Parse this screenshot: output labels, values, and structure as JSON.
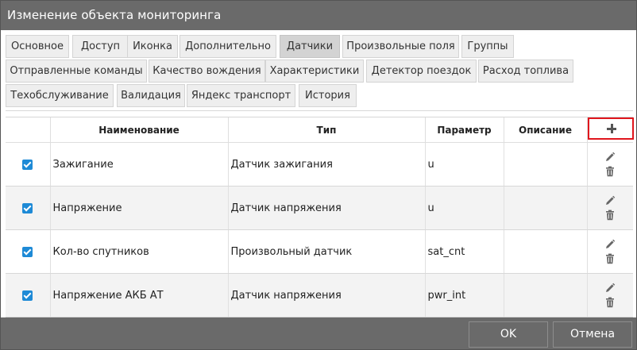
{
  "dialog": {
    "title": "Изменение объекта мониторинга"
  },
  "tabs_row1": [
    {
      "label": "Основное"
    },
    {
      "label": "Доступ"
    },
    {
      "label": "Иконка"
    },
    {
      "label": "Дополнительно"
    },
    {
      "label": "Датчики",
      "active": true
    },
    {
      "label": "Произвольные поля"
    },
    {
      "label": "Группы"
    }
  ],
  "tabs_row2": [
    {
      "label": "Отправленные команды"
    },
    {
      "label": "Качество вождения"
    },
    {
      "label": "Характеристики"
    },
    {
      "label": "Детектор поездок"
    },
    {
      "label": "Расход топлива"
    }
  ],
  "tabs_row3": [
    {
      "label": "Техобслуживание"
    },
    {
      "label": "Валидация"
    },
    {
      "label": "Яндекс транспорт"
    },
    {
      "label": "История"
    }
  ],
  "table": {
    "headers": {
      "name": "Наименование",
      "type": "Тип",
      "param": "Параметр",
      "desc": "Описание"
    },
    "rows": [
      {
        "checked": true,
        "name": "Зажигание",
        "type": "Датчик зажигания",
        "param": "u",
        "desc": ""
      },
      {
        "checked": true,
        "name": "Напряжение",
        "type": "Датчик напряжения",
        "param": "u",
        "desc": ""
      },
      {
        "checked": true,
        "name": "Кол-во спутников",
        "type": "Произвольный датчик",
        "param": "sat_cnt",
        "desc": ""
      },
      {
        "checked": true,
        "name": "Напряжение АКБ АТ",
        "type": "Датчик напряжения",
        "param": "pwr_int",
        "desc": ""
      }
    ]
  },
  "icons": {
    "add": "plus-icon",
    "edit": "pencil-icon",
    "delete": "trash-icon"
  },
  "colors": {
    "titlebar": "#6a6a6a",
    "checkbox": "#1e8ad6",
    "highlight": "#e0161d"
  },
  "footer": {
    "ok_label": "OK",
    "cancel_label": "Отмена"
  }
}
